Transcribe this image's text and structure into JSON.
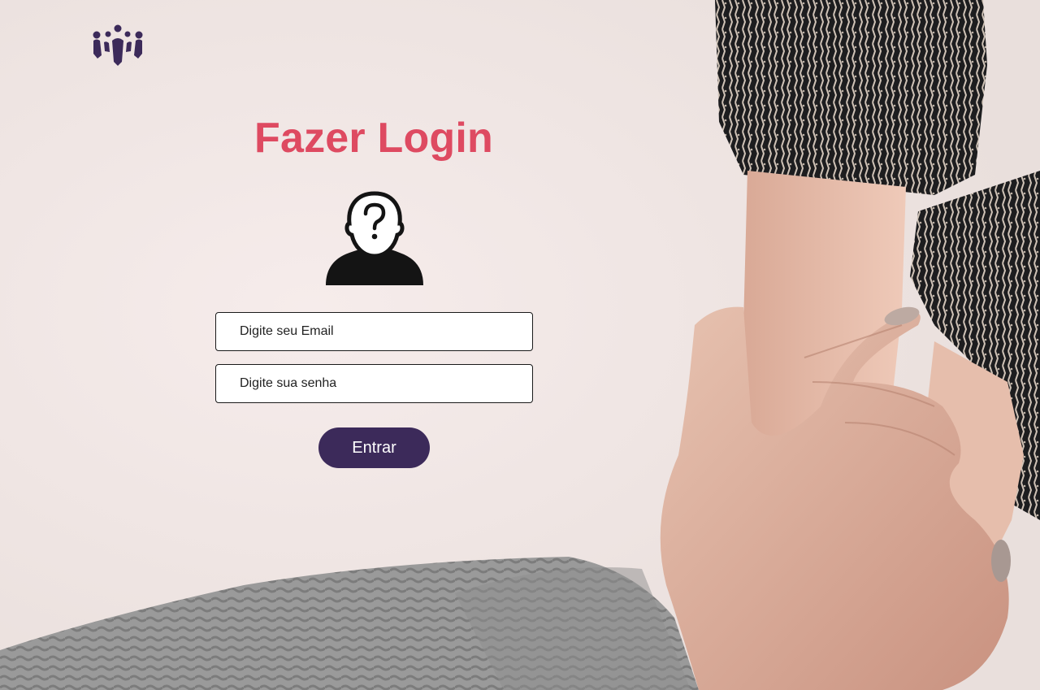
{
  "brand": {
    "logo_icon": "people-group-logo-icon",
    "color": "#3c2a5a"
  },
  "login": {
    "title": "Fazer Login",
    "title_color": "#de4a61",
    "avatar_icon": "unknown-user-icon",
    "email_placeholder": "Digite seu Email",
    "password_placeholder": "Digite sua senha",
    "submit_label": "Entrar",
    "submit_color": "#3c2a5a"
  },
  "background": {
    "description_icon": "holding-hands-photo"
  }
}
